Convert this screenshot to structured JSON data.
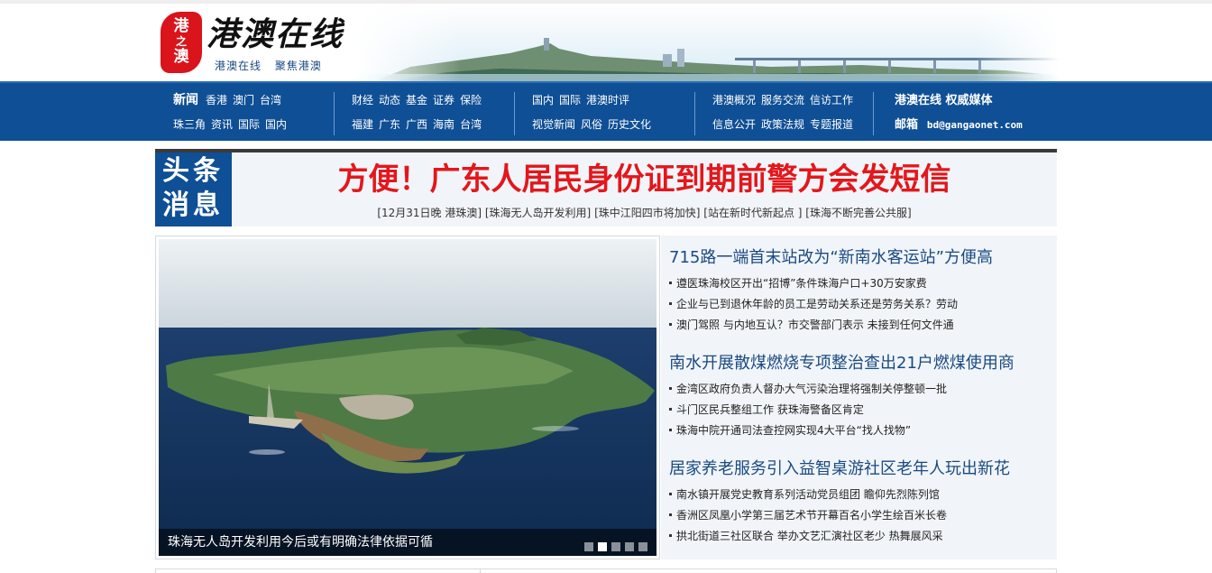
{
  "header": {
    "logo_seal": [
      "港",
      "之",
      "澳"
    ],
    "logo_text": "港澳在线",
    "slogan": "港澳在线 聚焦港澳"
  },
  "nav": {
    "group1": {
      "row1": [
        "新闻",
        "香港",
        "澳门",
        "台湾"
      ],
      "row2": [
        "珠三角",
        "资讯",
        "国际",
        "国内"
      ]
    },
    "group2": {
      "row1": [
        "财经",
        "动态",
        "基金",
        "证券",
        "保险"
      ],
      "row2": [
        "福建",
        "广东",
        "广西",
        "海南",
        "台湾"
      ]
    },
    "group3": {
      "row1": [
        "国内",
        "国际",
        "港澳时评"
      ],
      "row2": [
        "视觉新闻",
        "风俗",
        "历史文化"
      ]
    },
    "group4": {
      "row1": [
        "港澳概况",
        "服务交流",
        "信访工作"
      ],
      "row2": [
        "信息公开",
        "政策法规",
        "专题报道"
      ]
    },
    "group5": {
      "brand": "港澳在线 权威媒体",
      "email_label": "邮箱",
      "email": "bd@gangaonet.com"
    }
  },
  "headline": {
    "tag_line1": "头条",
    "tag_line2": "消息",
    "title": "方便！广东人居民身份证到期前警方会发短信",
    "links": [
      "[12月31日晚 港珠澳]",
      "[珠海无人岛开发利用]",
      "[珠中江阳四市将加快]",
      "[站在新时代新起点 ]",
      "[珠海不断完善公共服]"
    ]
  },
  "slider": {
    "caption": "珠海无人岛开发利用今后或有明确法律依据可循",
    "dots": 5,
    "active_dot": 2
  },
  "news": [
    {
      "title": "715路一端首末站改为“新南水客运站”方便高",
      "items": [
        "遵医珠海校区开出“招博”条件珠海户口+30万安家费",
        "企业与已到退休年龄的员工是劳动关系还是劳务关系？劳动",
        "澳门驾照 与内地互认？市交警部门表示 未接到任何文件通"
      ]
    },
    {
      "title": "南水开展散煤燃烧专项整治查出21户燃煤使用商",
      "items": [
        "金湾区政府负责人督办大气污染治理将强制关停整顿一批",
        "斗门区民兵整组工作 获珠海警备区肯定",
        "珠海中院开通司法查控网实现4大平台“找人找物”"
      ]
    },
    {
      "title": "居家养老服务引入益智桌游社区老年人玩出新花",
      "items": [
        "南水镇开展党史教育系列活动党员组团 瞻仰先烈陈列馆",
        "香洲区凤凰小学第三届艺术节开幕百名小学生绘百米长卷",
        "拱北街道三社区联合 举办文艺汇演社区老少 热舞展风采"
      ]
    }
  ],
  "colors": {
    "nav_blue": "#0f4f95",
    "headline_red": "#e3171c",
    "news_title_blue": "#1a4a82",
    "panel_bg": "#f1f5f9"
  }
}
